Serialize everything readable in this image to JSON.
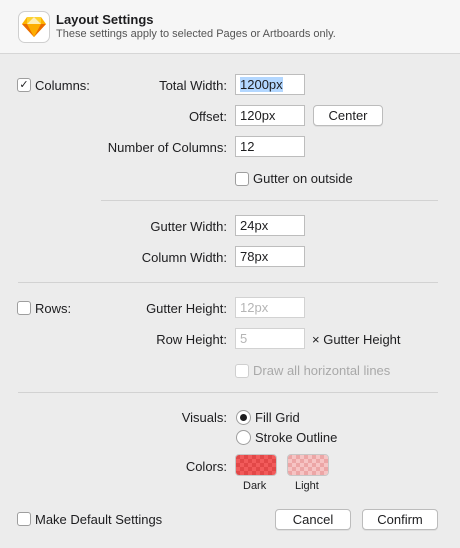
{
  "header": {
    "title": "Layout Settings",
    "subtitle": "These settings apply to selected Pages or Artboards only."
  },
  "columns": {
    "checkbox_label": "Columns:",
    "checked": true,
    "total_width_label": "Total Width:",
    "total_width_value": "1200px",
    "offset_label": "Offset:",
    "offset_value": "120px",
    "center_button": "Center",
    "number_label": "Number of Columns:",
    "number_value": "12",
    "gutter_outside_label": "Gutter on outside",
    "gutter_outside_checked": false,
    "gutter_width_label": "Gutter Width:",
    "gutter_width_value": "24px",
    "column_width_label": "Column Width:",
    "column_width_value": "78px"
  },
  "rows": {
    "checkbox_label": "Rows:",
    "checked": false,
    "gutter_height_label": "Gutter Height:",
    "gutter_height_placeholder": "12px",
    "row_height_label": "Row Height:",
    "row_height_placeholder": "5",
    "row_height_suffix": "× Gutter Height",
    "draw_lines_label": "Draw all horizontal lines",
    "draw_lines_checked": false
  },
  "visuals": {
    "label": "Visuals:",
    "options": [
      "Fill Grid",
      "Stroke Outline"
    ],
    "selected": "Fill Grid"
  },
  "colors": {
    "label": "Colors:",
    "dark_label": "Dark",
    "light_label": "Light",
    "dark_color": "#f25b5b",
    "light_color": "#f4b3b3"
  },
  "footer": {
    "default_label": "Make Default Settings",
    "default_checked": false,
    "cancel_button": "Cancel",
    "confirm_button": "Confirm"
  },
  "icons": {
    "app": "sketch-diamond-icon",
    "check": "✓"
  }
}
